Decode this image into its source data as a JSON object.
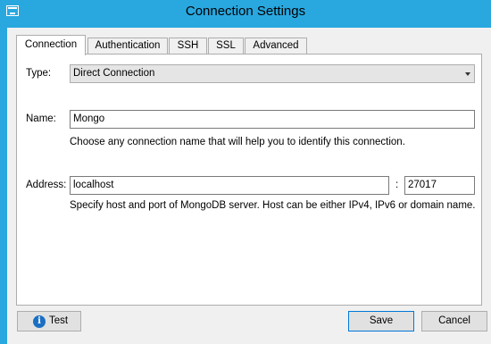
{
  "window": {
    "title": "Connection Settings"
  },
  "tabs": [
    {
      "label": "Connection"
    },
    {
      "label": "Authentication"
    },
    {
      "label": "SSH"
    },
    {
      "label": "SSL"
    },
    {
      "label": "Advanced"
    }
  ],
  "type": {
    "label": "Type:",
    "value": "Direct Connection"
  },
  "name": {
    "label": "Name:",
    "value": "Mongo",
    "hint": "Choose any connection name that will help you to identify this connection."
  },
  "address": {
    "label": "Address:",
    "host": "localhost",
    "separator": ":",
    "port": "27017",
    "hint": "Specify host and port of MongoDB server. Host can be either IPv4, IPv6 or domain name."
  },
  "buttons": {
    "test": "Test",
    "save": "Save",
    "cancel": "Cancel"
  },
  "icons": {
    "app": "window-app-icon",
    "test": "info-icon"
  },
  "colors": {
    "titlebar": "#29a8e0",
    "primary_border": "#0078d7"
  }
}
